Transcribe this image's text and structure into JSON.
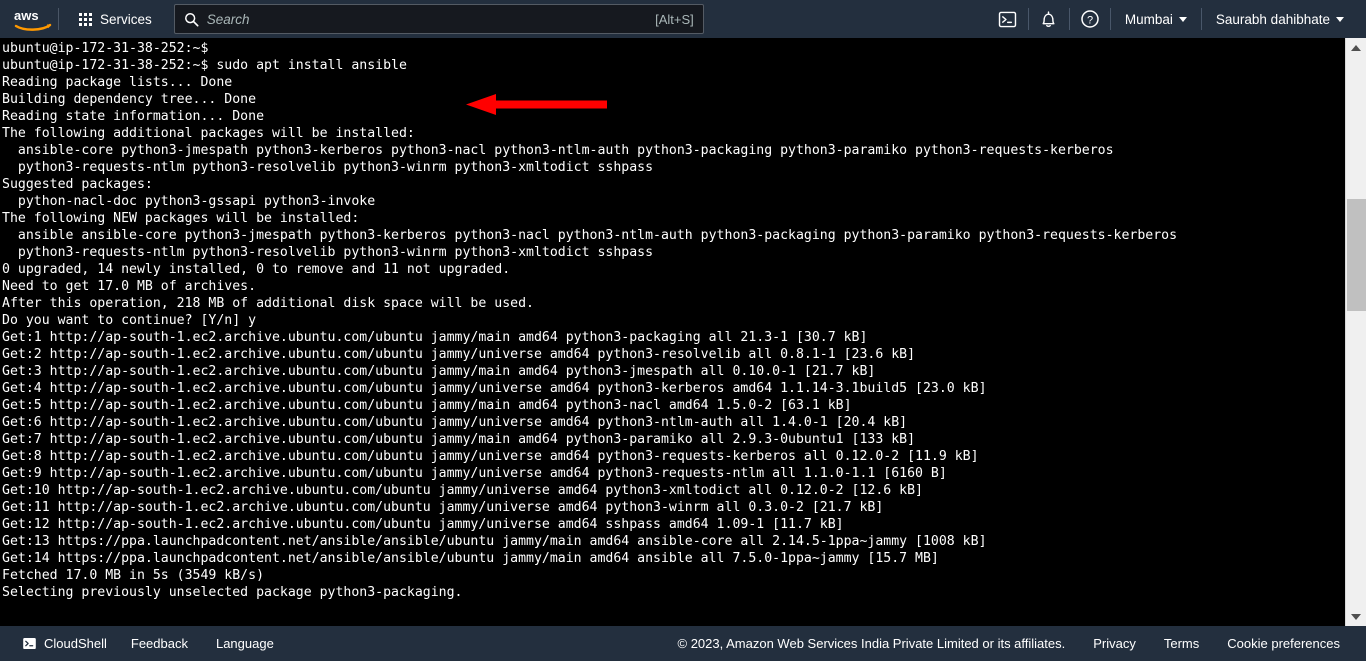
{
  "header": {
    "logo_alt": "aws",
    "services_label": "Services",
    "search": {
      "placeholder": "Search",
      "value": "",
      "shortcut_hint": "[Alt+S]"
    },
    "cloudshell_icon": "cloudshell-terminal-icon",
    "notifications_icon": "bell-icon",
    "help_icon": "help-circle-icon",
    "region_label": "Mumbai",
    "account_label": "Saurabh dahibhate"
  },
  "terminal": {
    "lines": [
      "ubuntu@ip-172-31-38-252:~$",
      "ubuntu@ip-172-31-38-252:~$ sudo apt install ansible",
      "Reading package lists... Done",
      "Building dependency tree... Done",
      "Reading state information... Done",
      "The following additional packages will be installed:",
      "  ansible-core python3-jmespath python3-kerberos python3-nacl python3-ntlm-auth python3-packaging python3-paramiko python3-requests-kerberos",
      "  python3-requests-ntlm python3-resolvelib python3-winrm python3-xmltodict sshpass",
      "Suggested packages:",
      "  python-nacl-doc python3-gssapi python3-invoke",
      "The following NEW packages will be installed:",
      "  ansible ansible-core python3-jmespath python3-kerberos python3-nacl python3-ntlm-auth python3-packaging python3-paramiko python3-requests-kerberos",
      "  python3-requests-ntlm python3-resolvelib python3-winrm python3-xmltodict sshpass",
      "0 upgraded, 14 newly installed, 0 to remove and 11 not upgraded.",
      "Need to get 17.0 MB of archives.",
      "After this operation, 218 MB of additional disk space will be used.",
      "Do you want to continue? [Y/n] y",
      "Get:1 http://ap-south-1.ec2.archive.ubuntu.com/ubuntu jammy/main amd64 python3-packaging all 21.3-1 [30.7 kB]",
      "Get:2 http://ap-south-1.ec2.archive.ubuntu.com/ubuntu jammy/universe amd64 python3-resolvelib all 0.8.1-1 [23.6 kB]",
      "Get:3 http://ap-south-1.ec2.archive.ubuntu.com/ubuntu jammy/main amd64 python3-jmespath all 0.10.0-1 [21.7 kB]",
      "Get:4 http://ap-south-1.ec2.archive.ubuntu.com/ubuntu jammy/universe amd64 python3-kerberos amd64 1.1.14-3.1build5 [23.0 kB]",
      "Get:5 http://ap-south-1.ec2.archive.ubuntu.com/ubuntu jammy/main amd64 python3-nacl amd64 1.5.0-2 [63.1 kB]",
      "Get:6 http://ap-south-1.ec2.archive.ubuntu.com/ubuntu jammy/universe amd64 python3-ntlm-auth all 1.4.0-1 [20.4 kB]",
      "Get:7 http://ap-south-1.ec2.archive.ubuntu.com/ubuntu jammy/main amd64 python3-paramiko all 2.9.3-0ubuntu1 [133 kB]",
      "Get:8 http://ap-south-1.ec2.archive.ubuntu.com/ubuntu jammy/universe amd64 python3-requests-kerberos all 0.12.0-2 [11.9 kB]",
      "Get:9 http://ap-south-1.ec2.archive.ubuntu.com/ubuntu jammy/universe amd64 python3-requests-ntlm all 1.1.0-1.1 [6160 B]",
      "Get:10 http://ap-south-1.ec2.archive.ubuntu.com/ubuntu jammy/universe amd64 python3-xmltodict all 0.12.0-2 [12.6 kB]",
      "Get:11 http://ap-south-1.ec2.archive.ubuntu.com/ubuntu jammy/universe amd64 python3-winrm all 0.3.0-2 [21.7 kB]",
      "Get:12 http://ap-south-1.ec2.archive.ubuntu.com/ubuntu jammy/universe amd64 sshpass amd64 1.09-1 [11.7 kB]",
      "Get:13 https://ppa.launchpadcontent.net/ansible/ansible/ubuntu jammy/main amd64 ansible-core all 2.14.5-1ppa~jammy [1008 kB]",
      "Get:14 https://ppa.launchpadcontent.net/ansible/ansible/ubuntu jammy/main amd64 ansible all 7.5.0-1ppa~jammy [15.7 MB]",
      "Fetched 17.0 MB in 5s (3549 kB/s)",
      "Selecting previously unselected package python3-packaging."
    ],
    "annotation": {
      "type": "arrow-left",
      "color": "#FF0000",
      "points_at": "sudo apt install ansible"
    }
  },
  "footer": {
    "cloudshell_label": "CloudShell",
    "feedback_label": "Feedback",
    "language_label": "Language",
    "copyright": "© 2023, Amazon Web Services India Private Limited or its affiliates.",
    "privacy_label": "Privacy",
    "terms_label": "Terms",
    "cookie_label": "Cookie preferences"
  },
  "colors": {
    "nav_background": "#232f3e",
    "terminal_background": "#000000",
    "terminal_text": "#ffffff",
    "accent_orange": "#ff9900",
    "annotation_red": "#ff0000"
  }
}
